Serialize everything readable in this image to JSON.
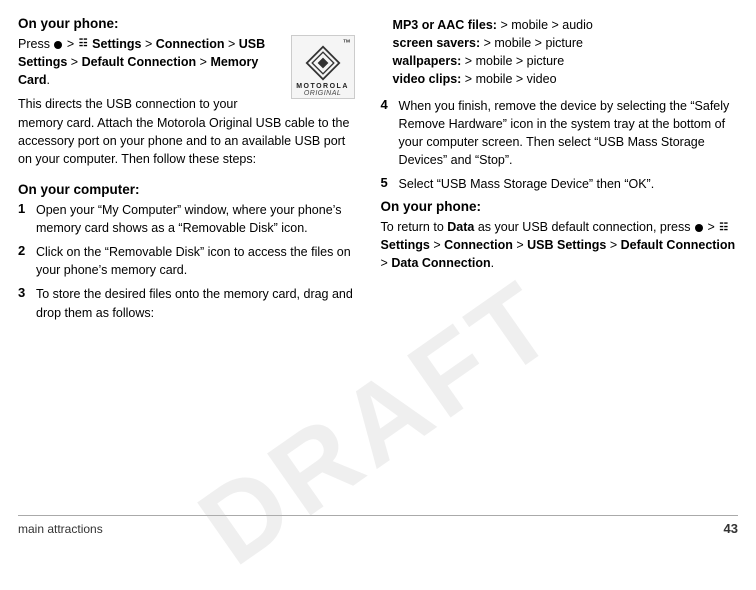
{
  "page": {
    "title": "On your phone:",
    "intro_press": "Press",
    "intro_menu_path": " > ",
    "intro_settings": "Settings",
    "intro_connection": "Connection",
    "intro_usb_settings": "USB Settings",
    "intro_default_connection": "Default Connection",
    "intro_memory_card": "Memory Card",
    "intro_period": ".",
    "intro_desc": "This directs the USB connection to your memory card. Attach the Motorola Original USB cable to the accessory port on your phone and to an available USB port on your computer. Then follow these steps:",
    "logo_tm": "™",
    "logo_brand": "MOTOROLA",
    "logo_sub": "ORIGINAL",
    "computer_heading": "On your computer:",
    "steps": [
      {
        "num": "1",
        "text": "Open your “My Computer” window, where your phone’s memory card shows as a “Removable Disk” icon."
      },
      {
        "num": "2",
        "text": "Click on the “Removable Disk” icon to access the files on your phone’s memory card."
      },
      {
        "num": "3",
        "text": "To store the desired files onto the memory card, drag and drop them as follows:"
      }
    ],
    "right_col": {
      "file_types": [
        {
          "label": "MP3 or AAC files:",
          "path": " > mobile > audio"
        },
        {
          "label": "screen savers:",
          "path": " > mobile > picture"
        },
        {
          "label": "wallpapers:",
          "path": " > mobile > picture"
        },
        {
          "label": "video clips:",
          "path": " > mobile > video"
        }
      ],
      "step4": {
        "num": "4",
        "text": "When you finish, remove the device by selecting the “Safely Remove Hardware” icon in the system tray at the bottom of your computer screen. Then select “USB Mass Storage Devices” and “Stop”."
      },
      "step5": {
        "num": "5",
        "text": "Select “USB Mass Storage Device” then “OK”."
      },
      "phone_heading": "On your phone:",
      "return_text": "To return to",
      "data_label": "Data",
      "return_mid": " as your USB default connection, press",
      "return_menu": "Settings",
      "return_connection": "Connection",
      "return_usb": "USB Settings",
      "return_default": "Default Connection",
      "return_data_conn": "Data Connection",
      "return_period": "."
    },
    "footer": {
      "left": "main attractions",
      "right": "43"
    },
    "watermark": "DRAFT"
  }
}
